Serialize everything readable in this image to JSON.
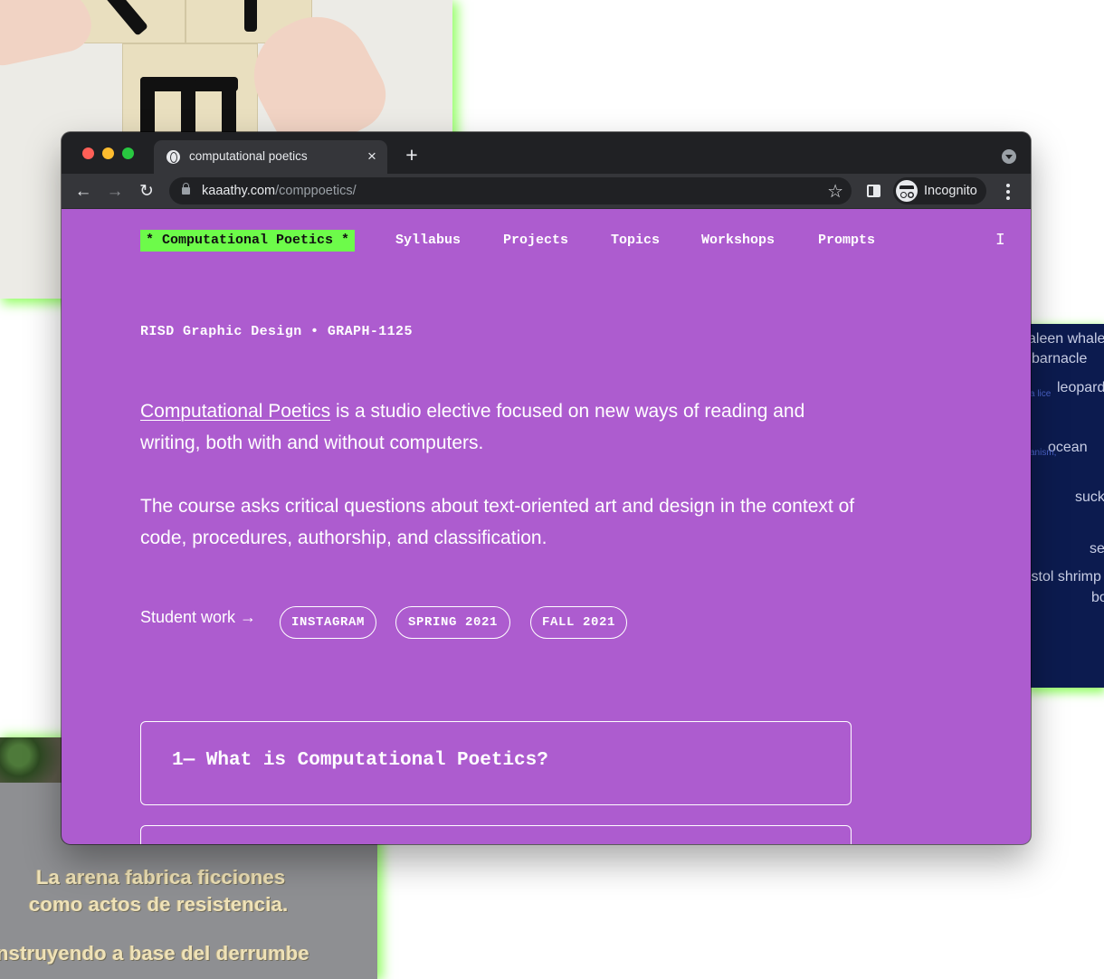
{
  "browser": {
    "tab_title": "computational poetics",
    "tab_close_icon": "×",
    "new_tab_icon": "+",
    "url_domain": "kaaathy.com",
    "url_path": "/comppoetics/",
    "back_icon": "←",
    "forward_icon": "→",
    "reload_icon": "↻",
    "bookmark_icon": "☆",
    "profile_label": "Incognito"
  },
  "site": {
    "brand": "* Computational Poetics *",
    "nav": [
      "Syllabus",
      "Projects",
      "Topics",
      "Workshops",
      "Prompts"
    ],
    "text_cursor_icon": "I",
    "meta": "RISD Graphic Design • GRAPH-1125",
    "intro_link": "Computational Poetics",
    "intro_rest": " is a studio elective focused on new ways of reading and writing, both with and without computers.",
    "course_text": "The course asks critical questions about text-oriented art and design in the context of code, procedures, authorship, and classification.",
    "student_work_label": "Student work →",
    "student_work_links": [
      "INSTAGRAM",
      "SPRING 2021",
      "FALL 2021"
    ],
    "sections": [
      {
        "title": "1— What is Computational Poetics?"
      }
    ]
  },
  "background": {
    "word_tile": [
      "aleen whale",
      "barnacle",
      "leopard",
      "a lice",
      "ocean",
      "anism,",
      "suck",
      "se",
      "istol shrimp",
      "bo"
    ],
    "stone_text": [
      "La arena fabrica ficciones",
      "como actos de resistencia.",
      "nstruyendo a base del derrumbe"
    ]
  },
  "colors": {
    "page_background": "#ad5ccf",
    "brand_highlight": "#6dfb4a",
    "glow": "#8cff5a",
    "chrome_dark": "#202124",
    "chrome_toolbar": "#35363a"
  }
}
